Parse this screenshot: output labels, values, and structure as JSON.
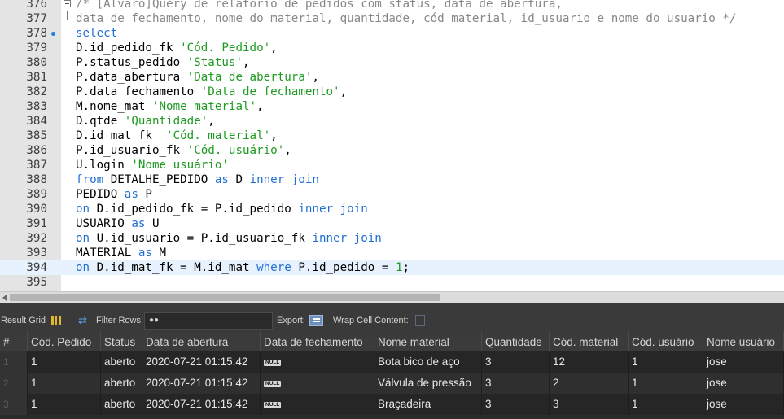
{
  "editor": {
    "lines": [
      {
        "num": "376",
        "fold": "box",
        "marker": false,
        "current": false,
        "tokens": [
          {
            "t": "cmt",
            "v": "/* [Álvaro]Query de relatório de pedidos com status, data de abertura,"
          }
        ]
      },
      {
        "num": "377",
        "fold": "end",
        "marker": false,
        "current": false,
        "tokens": [
          {
            "t": "cmt",
            "v": "data de fechamento, nome do material, quantidade, cód material, id_usuario e nome do usuario */"
          }
        ]
      },
      {
        "num": "378",
        "fold": "",
        "marker": true,
        "current": false,
        "tokens": [
          {
            "t": "kw",
            "v": "select"
          }
        ]
      },
      {
        "num": "379",
        "fold": "",
        "marker": false,
        "current": false,
        "tokens": [
          {
            "t": "id",
            "v": "D.id_pedido_fk "
          },
          {
            "t": "str",
            "v": "'Cód. Pedido'"
          },
          {
            "t": "id",
            "v": ","
          }
        ]
      },
      {
        "num": "380",
        "fold": "",
        "marker": false,
        "current": false,
        "tokens": [
          {
            "t": "id",
            "v": "P.status_pedido "
          },
          {
            "t": "str",
            "v": "'Status'"
          },
          {
            "t": "id",
            "v": ","
          }
        ]
      },
      {
        "num": "381",
        "fold": "",
        "marker": false,
        "current": false,
        "tokens": [
          {
            "t": "id",
            "v": "P.data_abertura "
          },
          {
            "t": "str",
            "v": "'Data de abertura'"
          },
          {
            "t": "id",
            "v": ","
          }
        ]
      },
      {
        "num": "382",
        "fold": "",
        "marker": false,
        "current": false,
        "tokens": [
          {
            "t": "id",
            "v": "P.data_fechamento "
          },
          {
            "t": "str",
            "v": "'Data de fechamento'"
          },
          {
            "t": "id",
            "v": ","
          }
        ]
      },
      {
        "num": "383",
        "fold": "",
        "marker": false,
        "current": false,
        "tokens": [
          {
            "t": "id",
            "v": "M.nome_mat "
          },
          {
            "t": "str",
            "v": "'Nome material'"
          },
          {
            "t": "id",
            "v": ","
          }
        ]
      },
      {
        "num": "384",
        "fold": "",
        "marker": false,
        "current": false,
        "tokens": [
          {
            "t": "id",
            "v": "D.qtde "
          },
          {
            "t": "str",
            "v": "'Quantidade'"
          },
          {
            "t": "id",
            "v": ","
          }
        ]
      },
      {
        "num": "385",
        "fold": "",
        "marker": false,
        "current": false,
        "tokens": [
          {
            "t": "id",
            "v": "D.id_mat_fk  "
          },
          {
            "t": "str",
            "v": "'Cód. material'"
          },
          {
            "t": "id",
            "v": ","
          }
        ]
      },
      {
        "num": "386",
        "fold": "",
        "marker": false,
        "current": false,
        "tokens": [
          {
            "t": "id",
            "v": "P.id_usuario_fk "
          },
          {
            "t": "str",
            "v": "'Cód. usuário'"
          },
          {
            "t": "id",
            "v": ","
          }
        ]
      },
      {
        "num": "387",
        "fold": "",
        "marker": false,
        "current": false,
        "tokens": [
          {
            "t": "id",
            "v": "U.login "
          },
          {
            "t": "str",
            "v": "'Nome usuário'"
          }
        ]
      },
      {
        "num": "388",
        "fold": "",
        "marker": false,
        "current": false,
        "tokens": [
          {
            "t": "kw",
            "v": "from"
          },
          {
            "t": "id",
            "v": " DETALHE_PEDIDO "
          },
          {
            "t": "kw",
            "v": "as"
          },
          {
            "t": "id",
            "v": " D "
          },
          {
            "t": "kw",
            "v": "inner join"
          }
        ]
      },
      {
        "num": "389",
        "fold": "",
        "marker": false,
        "current": false,
        "tokens": [
          {
            "t": "id",
            "v": "PEDIDO "
          },
          {
            "t": "kw",
            "v": "as"
          },
          {
            "t": "id",
            "v": " P"
          }
        ]
      },
      {
        "num": "390",
        "fold": "",
        "marker": false,
        "current": false,
        "tokens": [
          {
            "t": "kw",
            "v": "on"
          },
          {
            "t": "id",
            "v": " D.id_pedido_fk = P.id_pedido "
          },
          {
            "t": "kw",
            "v": "inner join"
          }
        ]
      },
      {
        "num": "391",
        "fold": "",
        "marker": false,
        "current": false,
        "tokens": [
          {
            "t": "id",
            "v": "USUARIO "
          },
          {
            "t": "kw",
            "v": "as"
          },
          {
            "t": "id",
            "v": " U"
          }
        ]
      },
      {
        "num": "392",
        "fold": "",
        "marker": false,
        "current": false,
        "tokens": [
          {
            "t": "kw",
            "v": "on"
          },
          {
            "t": "id",
            "v": " U.id_usuario = P.id_usuario_fk "
          },
          {
            "t": "kw",
            "v": "inner join"
          }
        ]
      },
      {
        "num": "393",
        "fold": "",
        "marker": false,
        "current": false,
        "tokens": [
          {
            "t": "id",
            "v": "MATERIAL "
          },
          {
            "t": "kw",
            "v": "as"
          },
          {
            "t": "id",
            "v": " M"
          }
        ]
      },
      {
        "num": "394",
        "fold": "",
        "marker": false,
        "current": true,
        "tokens": [
          {
            "t": "kw",
            "v": "on"
          },
          {
            "t": "id",
            "v": " D.id_mat_fk = M.id_mat "
          },
          {
            "t": "kw",
            "v": "where"
          },
          {
            "t": "id",
            "v": " P.id_pedido = "
          },
          {
            "t": "str",
            "v": "1"
          },
          {
            "t": "id",
            "v": ";"
          }
        ]
      },
      {
        "num": "395",
        "fold": "",
        "marker": false,
        "current": false,
        "tokens": []
      }
    ]
  },
  "toolbar": {
    "result_grid_label": "Result Grid",
    "filter_rows_label": "Filter Rows:",
    "filter_value": "",
    "export_label": "Export:",
    "wrap_label": "Wrap Cell Content:"
  },
  "grid": {
    "rownum_header": "#",
    "columns": [
      "Cód. Pedido",
      "Status",
      "Data de abertura",
      "Data de fechamento",
      "Nome material",
      "Quantidade",
      "Cód. material",
      "Cód. usuário",
      "Nome usuário"
    ],
    "null_label": "NULL",
    "rows": [
      {
        "num": "1",
        "cells": [
          "1",
          "aberto",
          "2020-07-21 01:15:42",
          null,
          "Bota bico de aço",
          "3",
          "12",
          "1",
          "jose"
        ]
      },
      {
        "num": "2",
        "cells": [
          "1",
          "aberto",
          "2020-07-21 01:15:42",
          null,
          "Válvula de pressão",
          "3",
          "2",
          "1",
          "jose"
        ]
      },
      {
        "num": "3",
        "cells": [
          "1",
          "aberto",
          "2020-07-21 01:15:42",
          null,
          "Braçadeira",
          "3",
          "3",
          "1",
          "jose"
        ]
      }
    ]
  }
}
